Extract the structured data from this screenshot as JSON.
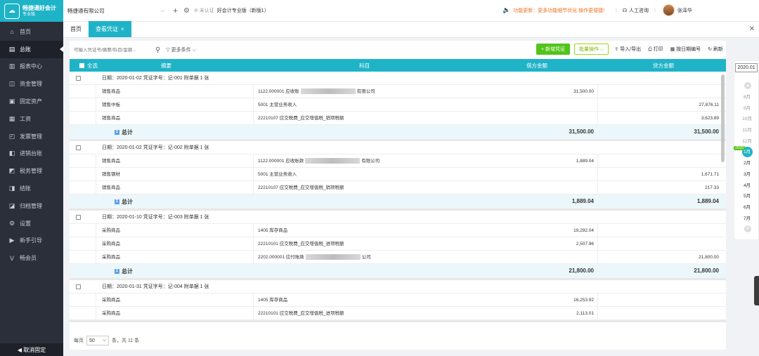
{
  "brand": {
    "name": "畅捷通好会计",
    "edition": "专业版"
  },
  "sidebar": {
    "items": [
      {
        "label": "首页",
        "icon": "home-icon",
        "glyph": "⌂"
      },
      {
        "label": "总账",
        "icon": "ledger-icon",
        "glyph": "▤"
      },
      {
        "label": "报表中心",
        "icon": "report-icon",
        "glyph": "▥"
      },
      {
        "label": "资金管理",
        "icon": "wallet-icon",
        "glyph": "◫"
      },
      {
        "label": "固定资产",
        "icon": "asset-icon",
        "glyph": "▣"
      },
      {
        "label": "工资",
        "icon": "salary-icon",
        "glyph": "▦"
      },
      {
        "label": "发票管理",
        "icon": "invoice-icon",
        "glyph": "◰"
      },
      {
        "label": "进销台账",
        "icon": "inventory-icon",
        "glyph": "◧"
      },
      {
        "label": "税务管理",
        "icon": "tax-icon",
        "glyph": "◩"
      },
      {
        "label": "结账",
        "icon": "close-book-icon",
        "glyph": "◨"
      },
      {
        "label": "归档管理",
        "icon": "archive-icon",
        "glyph": "◪"
      },
      {
        "label": "设置",
        "icon": "gear-icon",
        "glyph": "⚙"
      },
      {
        "label": "新手引导",
        "icon": "guide-icon",
        "glyph": "▶"
      },
      {
        "label": "畅会员",
        "icon": "member-icon",
        "glyph": "V"
      }
    ],
    "footer": "◀ 取消固定"
  },
  "topbar": {
    "company": "畅捷通有限公司",
    "cert": "未认证",
    "version": "好会计专业版（新版1）",
    "notice": "功能更新：更多功能细节优化 操作更便捷!",
    "support": "人工咨询",
    "user": "张泽华"
  },
  "tabs": {
    "home": "首页",
    "current": "查看凭证"
  },
  "toolbar": {
    "search_placeholder": "可输入凭证号/摘要/科目/金额...",
    "more_filters": "更多条件",
    "new_voucher": "+ 新增凭证",
    "batch": "批量操作",
    "import_export": "导入/导出",
    "print": "打印",
    "renumber": "按日期编号",
    "refresh": "刷新"
  },
  "table": {
    "headers": {
      "select_all": "全选",
      "summary": "摘要",
      "subject": "科目",
      "debit": "借方金额",
      "credit": "贷方金额"
    },
    "total_label": "总计",
    "vouchers": [
      {
        "header": "日期：2020-01-02    凭证字号：记-001    附单据 1 张",
        "lines": [
          {
            "summary": "销售商品",
            "subject_pre": "1122.000001  应收账",
            "subject_post": "有限公司",
            "debit": "31,500.00",
            "credit": ""
          },
          {
            "summary": "销售中板",
            "subject_pre": "5001 主营业务收入",
            "subject_post": "",
            "debit": "",
            "credit": "27,876.11"
          },
          {
            "summary": "销售商品",
            "subject_pre": "22210107 应交税费_应交增值税_销项税额",
            "subject_post": "",
            "debit": "",
            "credit": "3,623.89"
          }
        ],
        "total_debit": "31,500.00",
        "total_credit": "31,500.00"
      },
      {
        "header": "日期：2020-01-02    凭证字号：记-002    附单据 1 张",
        "lines": [
          {
            "summary": "销售商品",
            "subject_pre": "1122.000001  应收账款",
            "subject_post": "有限公司",
            "debit": "1,889.04",
            "credit": ""
          },
          {
            "summary": "销售钢材",
            "subject_pre": "5001 主营业务收入",
            "subject_post": "",
            "debit": "",
            "credit": "1,671.71"
          },
          {
            "summary": "销售商品",
            "subject_pre": "22210107 应交税费_应交增值税_销项税额",
            "subject_post": "",
            "debit": "",
            "credit": "217.33"
          }
        ],
        "total_debit": "1,889.04",
        "total_credit": "1,889.04"
      },
      {
        "header": "日期：2020-01-10    凭证字号：记-003    附单据 1 张",
        "lines": [
          {
            "summary": "采购商品",
            "subject_pre": "1405 库存商品",
            "subject_post": "",
            "debit": "19,292.04",
            "credit": ""
          },
          {
            "summary": "采购商品",
            "subject_pre": "22210101 应交税费_应交增值税_进项税额",
            "subject_post": "",
            "debit": "2,507.96",
            "credit": ""
          },
          {
            "summary": "采购商品",
            "subject_pre": "2202.000001  应付账款",
            "subject_post": "公司",
            "debit": "",
            "credit": "21,800.00"
          }
        ],
        "total_debit": "21,800.00",
        "total_credit": "21,800.00"
      },
      {
        "header": "日期：2020-01-31    凭证字号：记-004    附单据 1 张",
        "lines": [
          {
            "summary": "采购商品",
            "subject_pre": "1405 库存商品",
            "subject_post": "",
            "debit": "16,253.92",
            "credit": ""
          },
          {
            "summary": "采购商品",
            "subject_pre": "22210101 应交税费_应交增值税_进项税额",
            "subject_post": "",
            "debit": "2,113.01",
            "credit": ""
          }
        ],
        "total_debit": "",
        "total_credit": ""
      }
    ]
  },
  "pager": {
    "per_page_label": "每页",
    "per_page": "50",
    "total": "条，共 11 条"
  },
  "timeline": {
    "current_year": "2020.01",
    "year_tag": "2020",
    "months": [
      "8月",
      "9月",
      "10月",
      "11月",
      "12月",
      "1月",
      "2月",
      "3月",
      "4月",
      "5月",
      "6月",
      "7月"
    ],
    "current_month": "1月"
  },
  "colors": {
    "accent": "#1fb3c8",
    "sidebar": "#2b2f3a",
    "new_button": "#52c41a",
    "notice": "#f0701e"
  }
}
